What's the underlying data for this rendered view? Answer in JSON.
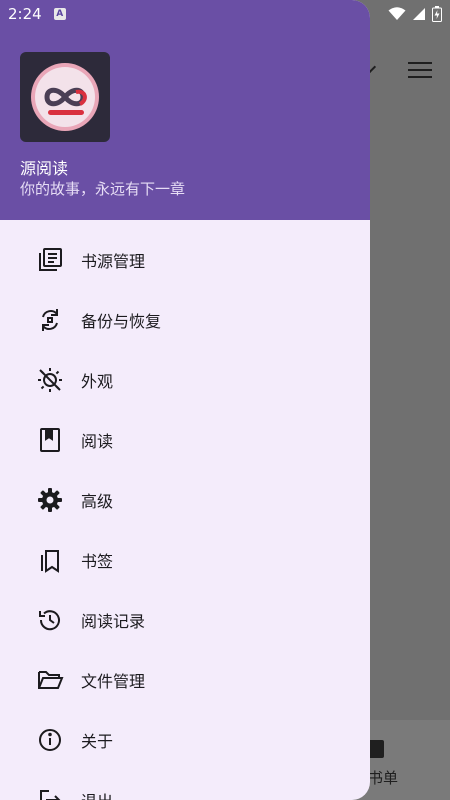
{
  "status_bar": {
    "time": "2:24",
    "indicator": "A"
  },
  "drawer": {
    "app_name": "源阅读",
    "slogan": "你的故事，永远有下一章",
    "items": [
      {
        "label": "书源管理",
        "icon": "book-source-icon"
      },
      {
        "label": "备份与恢复",
        "icon": "backup-restore-icon"
      },
      {
        "label": "外观",
        "icon": "theme-icon"
      },
      {
        "label": "阅读",
        "icon": "read-icon"
      },
      {
        "label": "高级",
        "icon": "gear-icon"
      },
      {
        "label": "书签",
        "icon": "bookmark-icon"
      },
      {
        "label": "阅读记录",
        "icon": "history-icon"
      },
      {
        "label": "文件管理",
        "icon": "folder-icon"
      },
      {
        "label": "关于",
        "icon": "info-icon"
      },
      {
        "label": "退出",
        "icon": "exit-icon"
      }
    ]
  },
  "background": {
    "bottom_label": "书单"
  },
  "colors": {
    "header": "#6a4fa5",
    "drawer_bg": "#f4ecfb",
    "icon": "#1c1b1f",
    "overlay": "#707070"
  }
}
